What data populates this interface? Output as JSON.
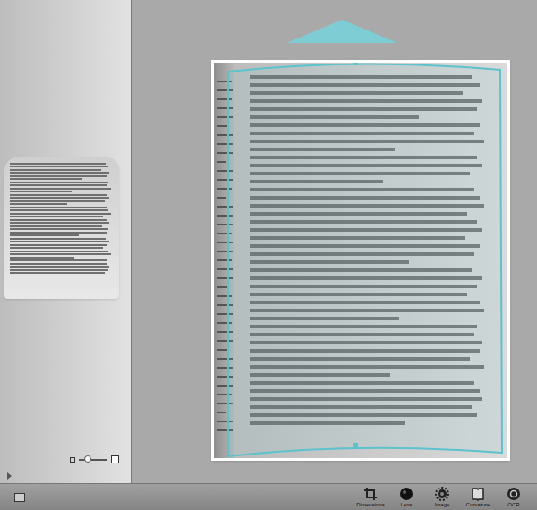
{
  "window": {
    "title": ""
  },
  "sidebar": {
    "zoom": {
      "level": 0.3
    }
  },
  "toolbar": {
    "buttons": [
      {
        "label": "Dimensions",
        "kind": "crop",
        "selected": false
      },
      {
        "label": "Lens",
        "kind": "lens",
        "selected": false
      },
      {
        "label": "Image",
        "kind": "gear",
        "selected": false
      },
      {
        "label": "Curvature",
        "kind": "bookmark",
        "selected": false
      },
      {
        "label": "OCR",
        "kind": "ocr",
        "selected": false
      }
    ]
  }
}
